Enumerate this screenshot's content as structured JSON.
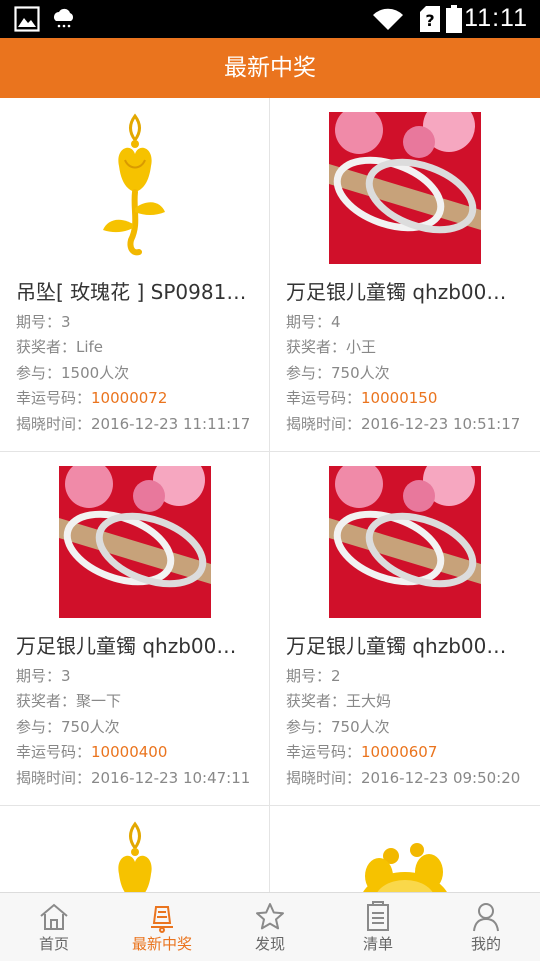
{
  "status_bar": {
    "time": "11:11"
  },
  "header": {
    "title": "最新中奖"
  },
  "items": [
    {
      "title": "吊坠[ 玫瑰花 ] SP0981…",
      "period": "期号：3",
      "winner": "获奖者：Life",
      "participants": "参与：1500人次",
      "lucky_label": "幸运号码：",
      "lucky_number": "10000072",
      "time": "揭晓时间：2016-12-23 11:11:17",
      "image": "rose-pendant"
    },
    {
      "title": "万足银儿童镯 qhzb00…",
      "period": "期号：4",
      "winner": "获奖者：小王",
      "participants": "参与：750人次",
      "lucky_label": "幸运号码：",
      "lucky_number": "10000150",
      "time": "揭晓时间：2016-12-23 10:51:17",
      "image": "silver-bracelet"
    },
    {
      "title": "万足银儿童镯 qhzb00…",
      "period": "期号：3",
      "winner": "获奖者：聚一下",
      "participants": "参与：750人次",
      "lucky_label": "幸运号码：",
      "lucky_number": "10000400",
      "time": "揭晓时间：2016-12-23 10:47:11",
      "image": "silver-bracelet"
    },
    {
      "title": "万足银儿童镯 qhzb00…",
      "period": "期号：2",
      "winner": "获奖者：王大妈",
      "participants": "参与：750人次",
      "lucky_label": "幸运号码：",
      "lucky_number": "10000607",
      "time": "揭晓时间：2016-12-23 09:50:20",
      "image": "silver-bracelet"
    }
  ],
  "tabs": [
    {
      "label": "首页",
      "icon": "home-icon",
      "active": false
    },
    {
      "label": "最新中奖",
      "icon": "bell-icon",
      "active": true
    },
    {
      "label": "发现",
      "icon": "star-icon",
      "active": false
    },
    {
      "label": "清单",
      "icon": "list-icon",
      "active": false
    },
    {
      "label": "我的",
      "icon": "person-icon",
      "active": false
    }
  ],
  "colors": {
    "accent": "#ea741e",
    "statusbar": "#000000",
    "text": "#333333",
    "muted": "#888888"
  }
}
